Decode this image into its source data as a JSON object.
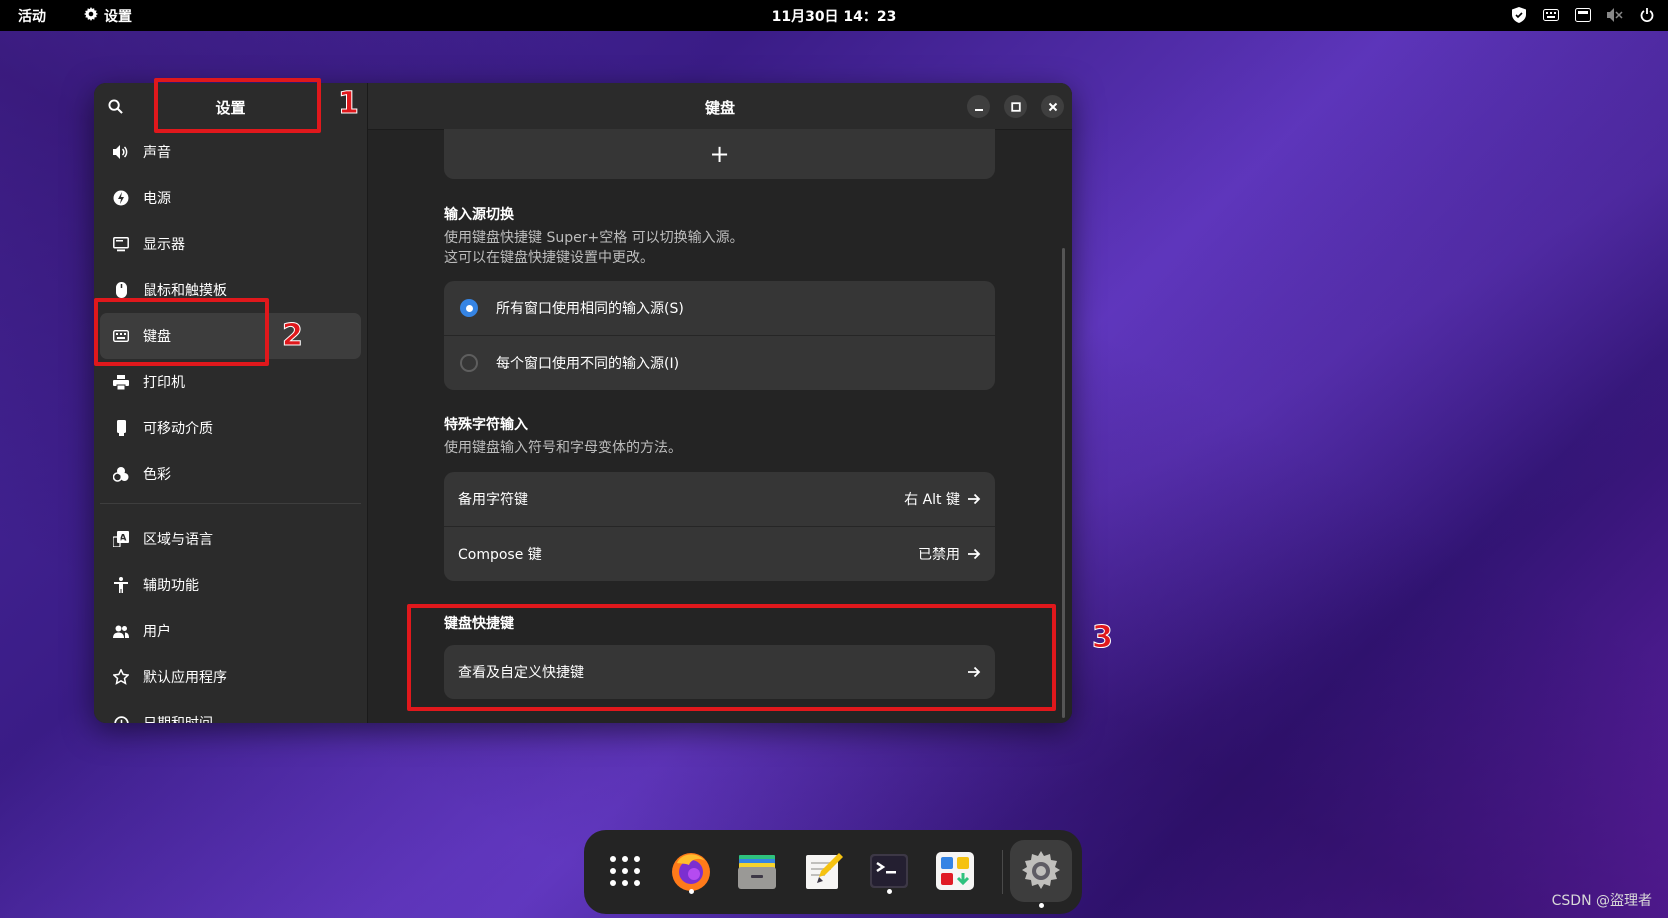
{
  "topbar": {
    "activities": "活动",
    "app_name": "设置",
    "clock": "11月30日  14：23",
    "tray_icons": [
      "shield-icon",
      "keyboard-icon",
      "network-icon",
      "volume-muted-icon",
      "power-icon"
    ]
  },
  "sidebar": {
    "title": "设置",
    "items": [
      {
        "label": "声音",
        "icon": "speaker-icon"
      },
      {
        "label": "电源",
        "icon": "power-bolt-icon"
      },
      {
        "label": "显示器",
        "icon": "monitor-icon"
      },
      {
        "label": "鼠标和触摸板",
        "icon": "mouse-icon"
      },
      {
        "label": "键盘",
        "icon": "keyboard-icon",
        "active": true
      },
      {
        "label": "打印机",
        "icon": "printer-icon"
      },
      {
        "label": "可移动介质",
        "icon": "usb-drive-icon"
      },
      {
        "label": "色彩",
        "icon": "color-icon"
      }
    ],
    "items2": [
      {
        "label": "区域与语言",
        "icon": "language-icon"
      },
      {
        "label": "辅助功能",
        "icon": "accessibility-icon"
      },
      {
        "label": "用户",
        "icon": "users-icon"
      },
      {
        "label": "默认应用程序",
        "icon": "star-icon"
      },
      {
        "label": "日期和时间",
        "icon": "clock-icon"
      }
    ]
  },
  "content": {
    "title": "键盘",
    "add_button": "+",
    "input_switch": {
      "title": "输入源切换",
      "desc1": "使用键盘快捷键 Super+空格 可以切换输入源。",
      "desc2": "这可以在键盘快捷键设置中更改。",
      "options": [
        {
          "label": "所有窗口使用相同的输入源(S)",
          "selected": true
        },
        {
          "label": "每个窗口使用不同的输入源(I)",
          "selected": false
        }
      ]
    },
    "special_chars": {
      "title": "特殊字符输入",
      "desc": "使用键盘输入符号和字母变体的方法。",
      "rows": [
        {
          "label": "备用字符键",
          "value": "右 Alt 键"
        },
        {
          "label": "Compose 键",
          "value": "已禁用"
        }
      ]
    },
    "shortcuts": {
      "title": "键盘快捷键",
      "row_label": "查看及自定义快捷键"
    }
  },
  "annotations": {
    "n1": "1",
    "n2": "2",
    "n3": "3",
    "color": "#e0181c"
  },
  "dock": {
    "apps": [
      "app-grid-icon",
      "firefox-icon",
      "files-icon",
      "text-editor-icon",
      "terminal-icon",
      "software-icon",
      "settings-icon"
    ]
  },
  "watermark": "CSDN @盜理者",
  "colors": {
    "accent": "#3584e4",
    "topbar": "#000000"
  }
}
